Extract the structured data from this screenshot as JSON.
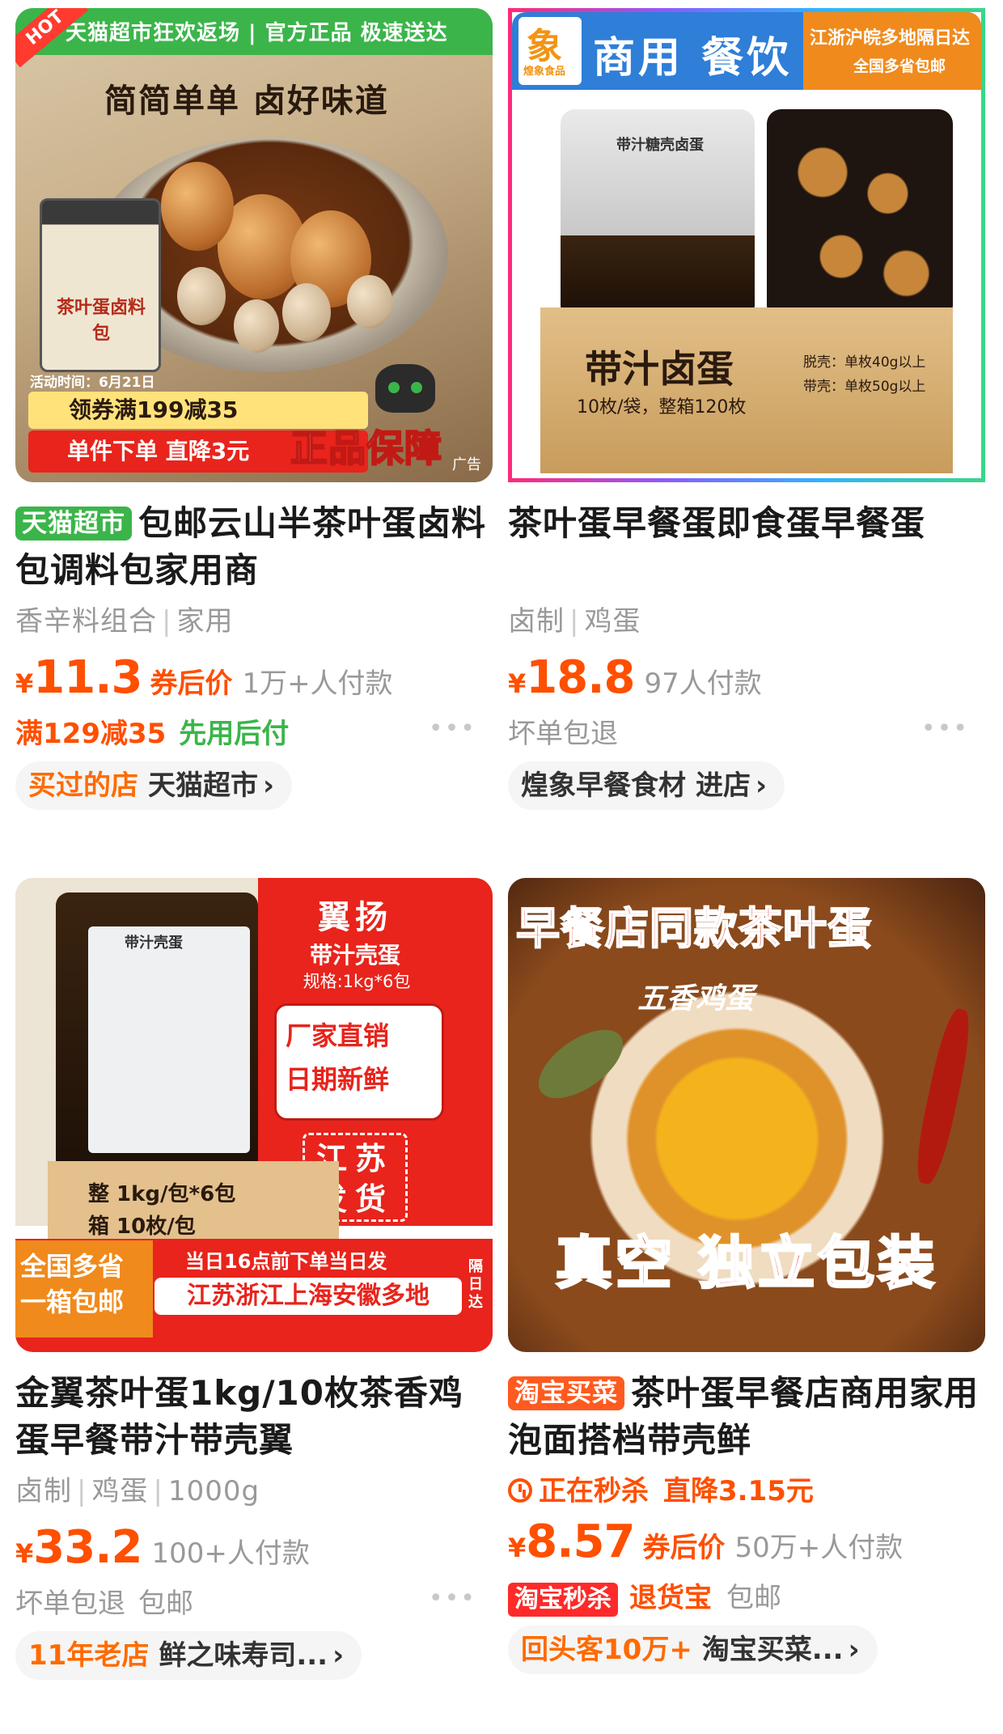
{
  "products": [
    {
      "image": {
        "hot": "HOT",
        "banner": "天猫超市狂欢返场 | 官方正品 极速送达",
        "slogan": "简简单单 卤好味道",
        "jar_label": "茶叶蛋卤料包",
        "activity": "活动时间：6月21日",
        "coupon": "领券满199减35",
        "direct_cut": "单件下单 直降3元",
        "genuine": "正品保障",
        "ad": "广告"
      },
      "tag": "天猫超市",
      "title": "包邮云山半茶叶蛋卤料包调料包家用商",
      "attrs": [
        "香辛料组合",
        "家用"
      ],
      "price_symbol": "¥",
      "price": "11.3",
      "price_note": "券后价",
      "paid": "1万+人付款",
      "promo": "满129减35",
      "promo2": "先用后付",
      "store_tag": "买过的店",
      "store_name": "天猫超市",
      "chevron": "›",
      "more": "•••"
    },
    {
      "image": {
        "logo_mark": "象",
        "logo_sub": "煌象食品",
        "band_title": "商用 餐饮",
        "badge_1": "江浙沪皖多地隔日达",
        "badge_2": "全国多省包邮",
        "bag_label": "带汁糖壳卤蛋",
        "box_title": "带汁卤蛋",
        "box_sub": "10枚/袋，整箱120枚",
        "spec_1": "脱壳：单枚40g以上",
        "spec_2": "带壳：单枚50g以上"
      },
      "title": "茶叶蛋早餐蛋即食蛋早餐蛋",
      "attrs": [
        "卤制",
        "鸡蛋"
      ],
      "price_symbol": "¥",
      "price": "18.8",
      "paid": "97人付款",
      "promo": "坏单包退",
      "store_name": "煌象早餐食材",
      "store_enter": "进店",
      "chevron": "›",
      "more": "•••"
    },
    {
      "image": {
        "bag_title": "带汁壳蛋",
        "brand": "翼扬",
        "brand_sub": "带汁壳蛋",
        "spec": "规格:1kg*6包",
        "factory_1": "厂家直销",
        "factory_2": "日期新鲜",
        "jiangsu": "江苏发货",
        "box_1": "整  1kg/包*6包",
        "box_2": "箱  10枚/包",
        "nation": "全国多省一箱包邮",
        "sameday": "当日16点前下单当日发",
        "regions": "江苏浙江上海安徽多地",
        "nextday": "隔日达"
      },
      "title": "金翼茶叶蛋1kg/10枚茶香鸡蛋早餐带汁带壳翼",
      "attrs": [
        "卤制",
        "鸡蛋",
        "1000g"
      ],
      "price_symbol": "¥",
      "price": "33.2",
      "paid": "100+人付款",
      "promo": "坏单包退",
      "promo2": "包邮",
      "store_tag": "11年老店",
      "store_name": "鲜之味寿司...",
      "chevron": "›",
      "more": "•••"
    },
    {
      "image": {
        "headline": "早餐店同款茶叶蛋",
        "spice": "五香鸡蛋",
        "vacuum": "真空 独立包装"
      },
      "tag": "淘宝买菜",
      "title": "茶叶蛋早餐店商用家用泡面搭档带壳鲜",
      "flash_1": "正在秒杀",
      "flash_2": "直降3.15元",
      "price_symbol": "¥",
      "price": "8.57",
      "price_note": "券后价",
      "paid": "50万+人付款",
      "tb_flash": "淘宝秒杀",
      "tuihuo": "退货宝",
      "baoyou": "包邮",
      "store_tag": "回头客10万+",
      "store_name": "淘宝买菜...",
      "chevron": "›"
    }
  ]
}
